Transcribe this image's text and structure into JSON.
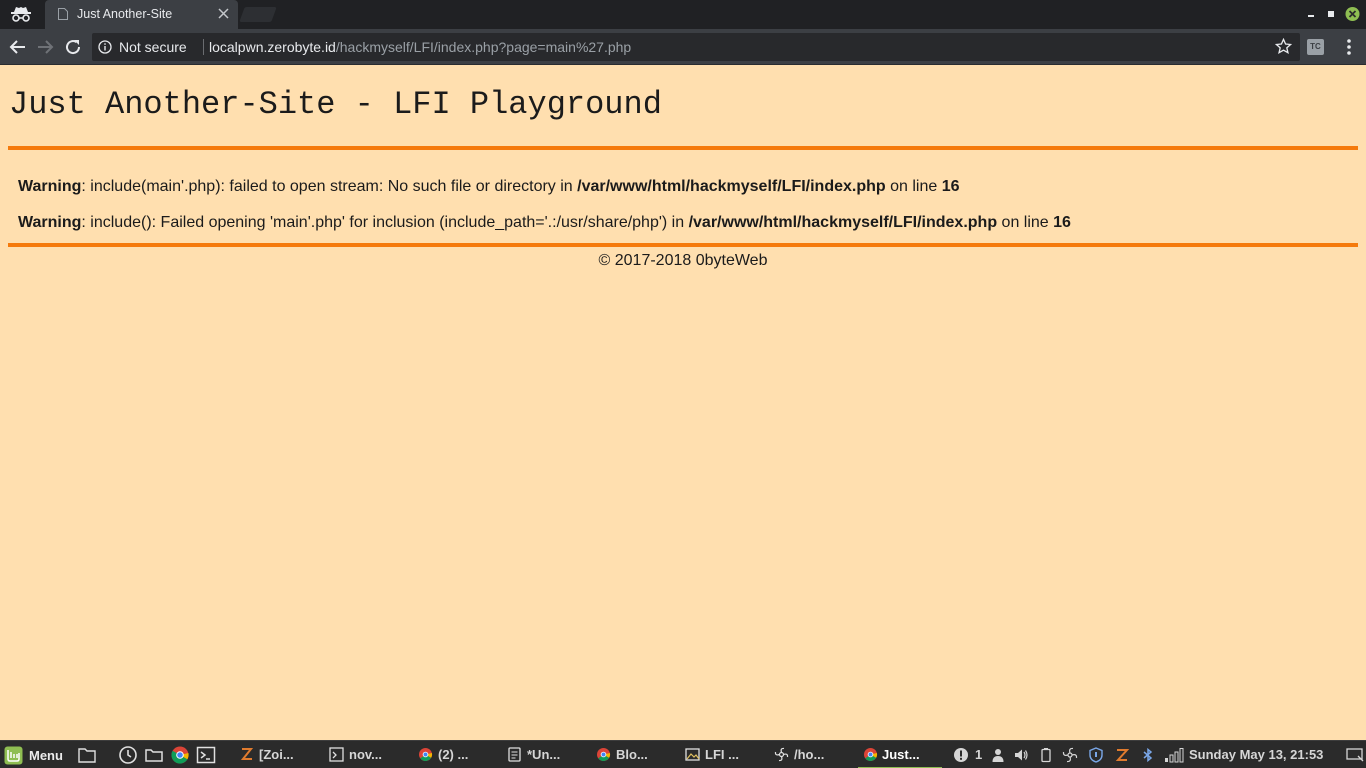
{
  "browser": {
    "tab_title": "Just Another-Site",
    "security_label": "Not secure",
    "url_host": "localpwn.zerobyte.id",
    "url_path": "/hackmyself/LFI/index.php?page=main%27.php",
    "extension_label": "TC"
  },
  "page": {
    "title": "Just Another-Site - LFI Playground",
    "warnings": [
      {
        "label": "Warning",
        "message": ": include(main'.php): failed to open stream: No such file or directory in ",
        "file": "/var/www/html/hackmyself/LFI/index.php",
        "on_line": " on line ",
        "line": "16"
      },
      {
        "label": "Warning",
        "message": ": include(): Failed opening 'main'.php' for inclusion (include_path='.:/usr/share/php') in ",
        "file": "/var/www/html/hackmyself/LFI/index.php",
        "on_line": " on line ",
        "line": "16"
      }
    ],
    "footer": "© 2017-2018 0byteWeb"
  },
  "taskbar": {
    "menu_label": "Menu",
    "windows": [
      {
        "label": "[Zoi...",
        "icon": "zotero-icon"
      },
      {
        "label": "nov...",
        "icon": "terminal-icon"
      },
      {
        "label": "(2) ...",
        "icon": "chrome-icon"
      },
      {
        "label": "*Un...",
        "icon": "text-editor-icon"
      },
      {
        "label": "Blo...",
        "icon": "chrome-icon"
      },
      {
        "label": "LFI ...",
        "icon": "image-viewer-icon"
      },
      {
        "label": "/ho...",
        "icon": "fan-icon"
      },
      {
        "label": "Just...",
        "icon": "chrome-icon",
        "active": true
      }
    ],
    "notification_count": "1",
    "clock": "Sunday May 13, 21:53"
  },
  "colors": {
    "page_background": "#ffdfaf",
    "rule_orange": "#f57a0c",
    "chrome_dark": "#202124",
    "toolbar": "#3c3f44",
    "taskbar": "#2b2b2b",
    "mint_green": "#8fbe52"
  }
}
